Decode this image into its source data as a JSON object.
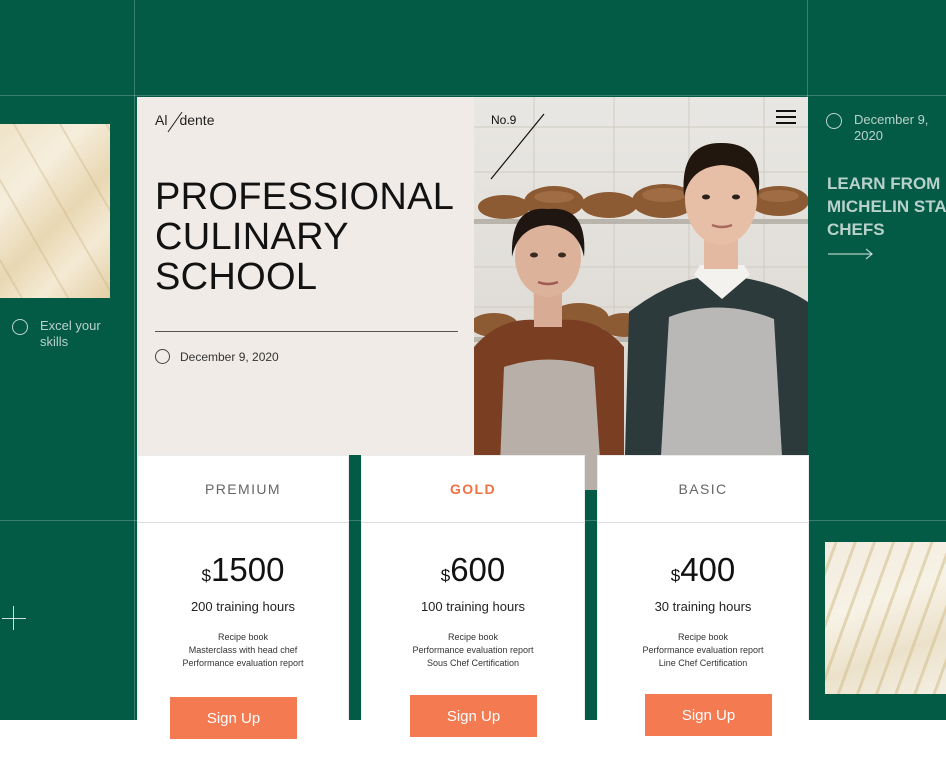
{
  "colors": {
    "green": "#035a45",
    "accent": "#f47a52",
    "cream": "#f0ebe6"
  },
  "side_left": {
    "feature_text": "Excel your skills",
    "icons": [
      "circle-icon",
      "plus-icon"
    ]
  },
  "side_right": {
    "date": "December 9, 2020",
    "heading": [
      "LEARN FROM",
      "MICHELIN STA",
      "CHEFS"
    ],
    "icons": [
      "circle-icon",
      "arrow-right-icon"
    ]
  },
  "hero": {
    "brand_left": "Al",
    "brand_right": "dente",
    "title_lines": [
      "PROFESSIONAL",
      "CULINARY",
      "SCHOOL"
    ],
    "date": "December 9, 2020",
    "badge": "No.9",
    "icons": [
      "menu-icon"
    ]
  },
  "plans": [
    {
      "name": "PREMIUM",
      "currency": "$",
      "price": "1500",
      "hours": "200 training hours",
      "features": [
        "Recipe book",
        "Masterclass with head chef",
        "Performance evaluation report"
      ],
      "cta": "Sign Up"
    },
    {
      "name": "GOLD",
      "currency": "$",
      "price": "600",
      "hours": "100 training hours",
      "features": [
        "Recipe book",
        "Performance evaluation report",
        "Sous Chef Certification"
      ],
      "cta": "Sign Up"
    },
    {
      "name": "BASIC",
      "currency": "$",
      "price": "400",
      "hours": "30 training hours",
      "features": [
        "Recipe book",
        "Performance evaluation report",
        "Line Chef Certification"
      ],
      "cta": "Sign Up"
    }
  ]
}
